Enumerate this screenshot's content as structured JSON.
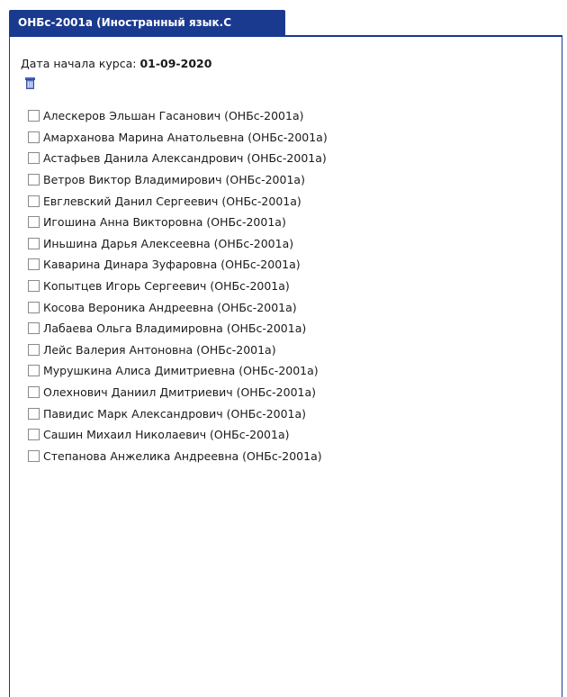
{
  "tab": {
    "label": "ОНБс-2001а (Иностранный язык.С"
  },
  "course": {
    "start_label": "Дата начала курса:",
    "start_date": "01-09-2020"
  },
  "icons": {
    "delete": "trash-icon"
  },
  "students": [
    {
      "label": "Алескеров Эльшан Гасанович (ОНБс-2001а)",
      "checked": false
    },
    {
      "label": "Амарханова Марина Анатольевна (ОНБс-2001а)",
      "checked": false
    },
    {
      "label": "Астафьев Данила Александрович (ОНБс-2001а)",
      "checked": false
    },
    {
      "label": "Ветров Виктор Владимирович (ОНБс-2001а)",
      "checked": false
    },
    {
      "label": "Евглевский Данил Сергеевич (ОНБс-2001а)",
      "checked": false
    },
    {
      "label": "Игошина Анна Викторовна (ОНБс-2001а)",
      "checked": false
    },
    {
      "label": "Иньшина Дарья Алексеевна (ОНБс-2001а)",
      "checked": false
    },
    {
      "label": "Каварина Динара Зуфаровна (ОНБс-2001а)",
      "checked": false
    },
    {
      "label": "Копытцев Игорь Сергеевич (ОНБс-2001а)",
      "checked": false
    },
    {
      "label": "Косова Вероника Андреевна (ОНБс-2001а)",
      "checked": false
    },
    {
      "label": "Лабаева Ольга Владимировна (ОНБс-2001а)",
      "checked": false
    },
    {
      "label": "Лейс Валерия Антоновна (ОНБс-2001а)",
      "checked": false
    },
    {
      "label": "Мурушкина Алиса Димитриевна (ОНБс-2001а)",
      "checked": false
    },
    {
      "label": "Олехнович Даниил Дмитриевич (ОНБс-2001а)",
      "checked": false
    },
    {
      "label": "Павидис Марк Александрович (ОНБс-2001а)",
      "checked": false
    },
    {
      "label": "Сашин Михаил Николаевич (ОНБс-2001а)",
      "checked": false
    },
    {
      "label": "Степанова Анжелика Андреевна (ОНБс-2001а)",
      "checked": false
    }
  ],
  "colors": {
    "tab_background": "#1a3a8f",
    "tab_text": "#ffffff",
    "panel_border": "#1a3a8f"
  }
}
